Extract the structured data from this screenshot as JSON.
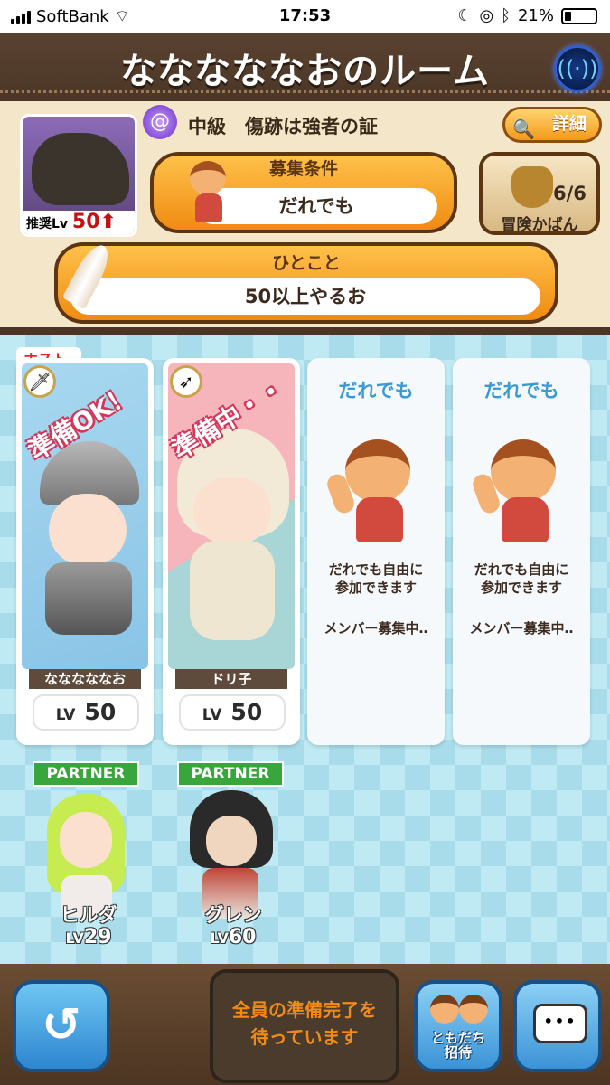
{
  "status_bar": {
    "carrier": "SoftBank",
    "time": "17:53",
    "battery": "21%"
  },
  "header": {
    "title": "なななななおのルーム"
  },
  "quest": {
    "name": "中級　傷跡は強者の証",
    "recommended_label": "推奨Lv",
    "recommended_level": "50",
    "detail_label": "詳細",
    "condition_header": "募集条件",
    "condition_value": "だれでも",
    "bag_count": "6/6",
    "bag_label": "冒険かばん",
    "message_header": "ひとこと",
    "message_value": "50以上やるお"
  },
  "host_tag": "ホスト",
  "members": [
    {
      "name": "なななななお",
      "lv_label": "LV",
      "level": "50",
      "status": "準備OK！",
      "color": "#2f7fd8"
    },
    {
      "name": "ドリ子",
      "lv_label": "LV",
      "level": "50",
      "status": "準備中・・",
      "color": "#d4365a"
    }
  ],
  "open_slots": [
    {
      "header": "だれでも",
      "desc1": "だれでも自由に",
      "desc2": "参加できます",
      "recruit": "メンバー募集中‥"
    },
    {
      "header": "だれでも",
      "desc1": "だれでも自由に",
      "desc2": "参加できます",
      "recruit": "メンバー募集中‥"
    }
  ],
  "partners": [
    {
      "tag": "PARTNER",
      "name": "ヒルダ",
      "lv_label": "LV",
      "level": "29"
    },
    {
      "tag": "PARTNER",
      "name": "グレン",
      "lv_label": "LV",
      "level": "60"
    }
  ],
  "footer": {
    "waiting_line1": "全員の準備完了を",
    "waiting_line2": "待っています",
    "invite_line1": "ともだち",
    "invite_line2": "招待"
  }
}
